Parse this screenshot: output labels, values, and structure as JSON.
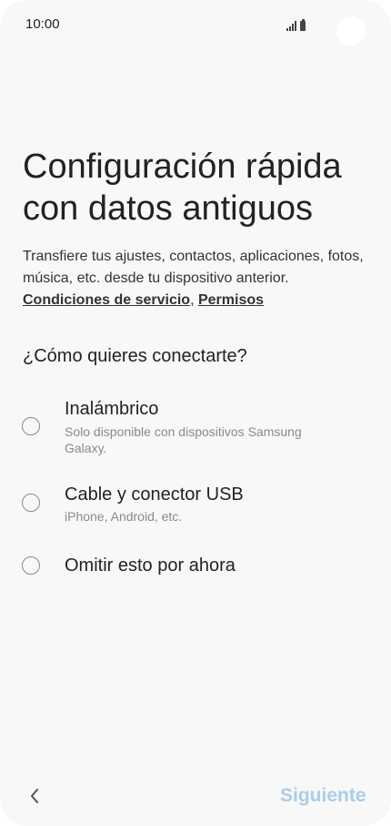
{
  "status_bar": {
    "time": "10:00"
  },
  "header": {
    "title": "Configuración rápida con datos antiguos"
  },
  "description": {
    "text": "Transfiere tus ajustes, contactos, aplicaciones, fotos, música, etc. desde tu dispositivo anterior.",
    "terms_link": "Condiciones de servicio",
    "separator": ",",
    "permissions_link": "Permisos"
  },
  "connection": {
    "question": "¿Cómo quieres conectarte?",
    "options": [
      {
        "label": "Inalámbrico",
        "sublabel": "Solo disponible con dispositivos Samsung Galaxy.",
        "selected": false
      },
      {
        "label": "Cable y conector USB",
        "sublabel": "iPhone, Android, etc.",
        "selected": false
      },
      {
        "label": "Omitir esto por ahora",
        "selected": false
      }
    ]
  },
  "footer": {
    "back_icon": "chevron-left-icon",
    "next_label": "Siguiente",
    "next_color": "#a9cdee"
  },
  "colors": {
    "background": "#f8f8f8",
    "text": "#222222",
    "secondary_text": "#8a8a8a",
    "disabled_accent": "#a9cdee"
  }
}
